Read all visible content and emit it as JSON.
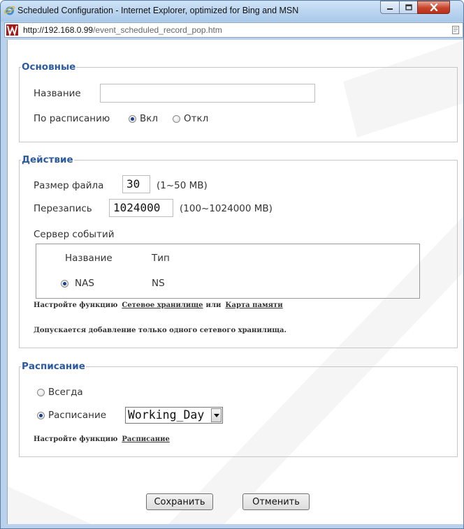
{
  "window": {
    "title": "Scheduled Configuration - Internet Explorer, optimized for Bing and MSN",
    "address_host": "http://192.168.0.99",
    "address_path": "/event_scheduled_record_pop.htm"
  },
  "general": {
    "legend": "Основные",
    "name_label": "Название",
    "name_value": "",
    "schedule_label": "По расписанию",
    "on_label": "Вкл",
    "off_label": "Откл",
    "schedule_on": true
  },
  "action": {
    "legend": "Действие",
    "file_size_label": "Размер файла",
    "file_size_value": "30",
    "file_size_range": "(1~50 MB)",
    "overwrite_label": "Перезапись",
    "overwrite_value": "1024000",
    "overwrite_range": "(100~1024000 MB)",
    "event_server_label": "Сервер событий",
    "table": {
      "columns": [
        "Название",
        "Тип"
      ],
      "rows": [
        {
          "name": "NAS",
          "type": "NS",
          "selected": true
        }
      ]
    },
    "configure_prefix": "Настройте функцию",
    "configure_link1": "Сетевое хранилище",
    "configure_or": "или",
    "configure_link2": "Карта памяти",
    "note": "Допускается добавление только одного сетевого хранилища."
  },
  "schedule": {
    "legend": "Расписание",
    "always_label": "Всегда",
    "schedule_label": "Расписание",
    "selected_option": "Working_Day",
    "configure_prefix": "Настройте функцию",
    "configure_link": "Расписание"
  },
  "buttons": {
    "save": "Сохранить",
    "cancel": "Отменить"
  },
  "colors": {
    "legend": "#2b5aa0",
    "radio_dot": "#1c3f8c",
    "titlebar": "#b9d1ea",
    "close_button": "#c7432a"
  }
}
